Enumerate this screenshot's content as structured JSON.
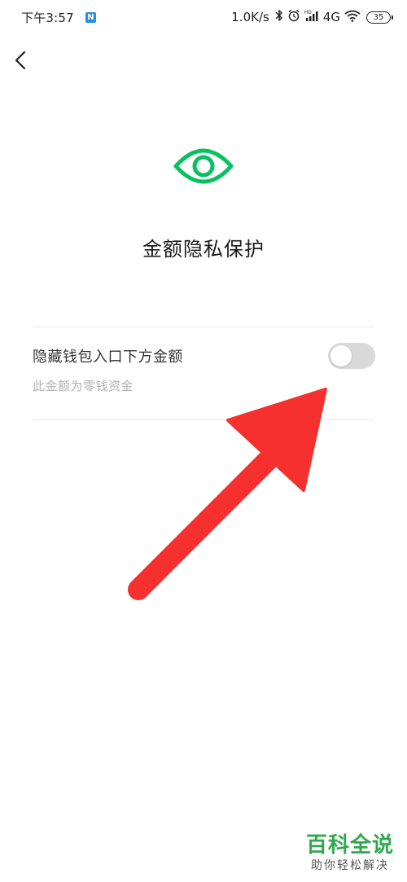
{
  "status_bar": {
    "time": "下午3:57",
    "app_badge": "N",
    "network_speed": "1.0K/s",
    "network_type": "4G",
    "battery_level": "35"
  },
  "page": {
    "title": "金额隐私保护"
  },
  "setting": {
    "label": "隐藏钱包入口下方金额",
    "description": "此金额为零钱资金",
    "enabled": false
  },
  "watermark": {
    "main": "百科全说",
    "sub": "助你轻松解决"
  },
  "colors": {
    "accent": "#07c160",
    "arrow": "#f5302e",
    "toggle_off": "#d9d9d9",
    "watermark": "#2fa84f"
  },
  "icons": {
    "back": "chevron-left-icon",
    "privacy": "eye-icon",
    "bluetooth": "bluetooth-icon",
    "alarm": "alarm-icon",
    "signal": "signal-icon",
    "wifi": "wifi-icon"
  }
}
